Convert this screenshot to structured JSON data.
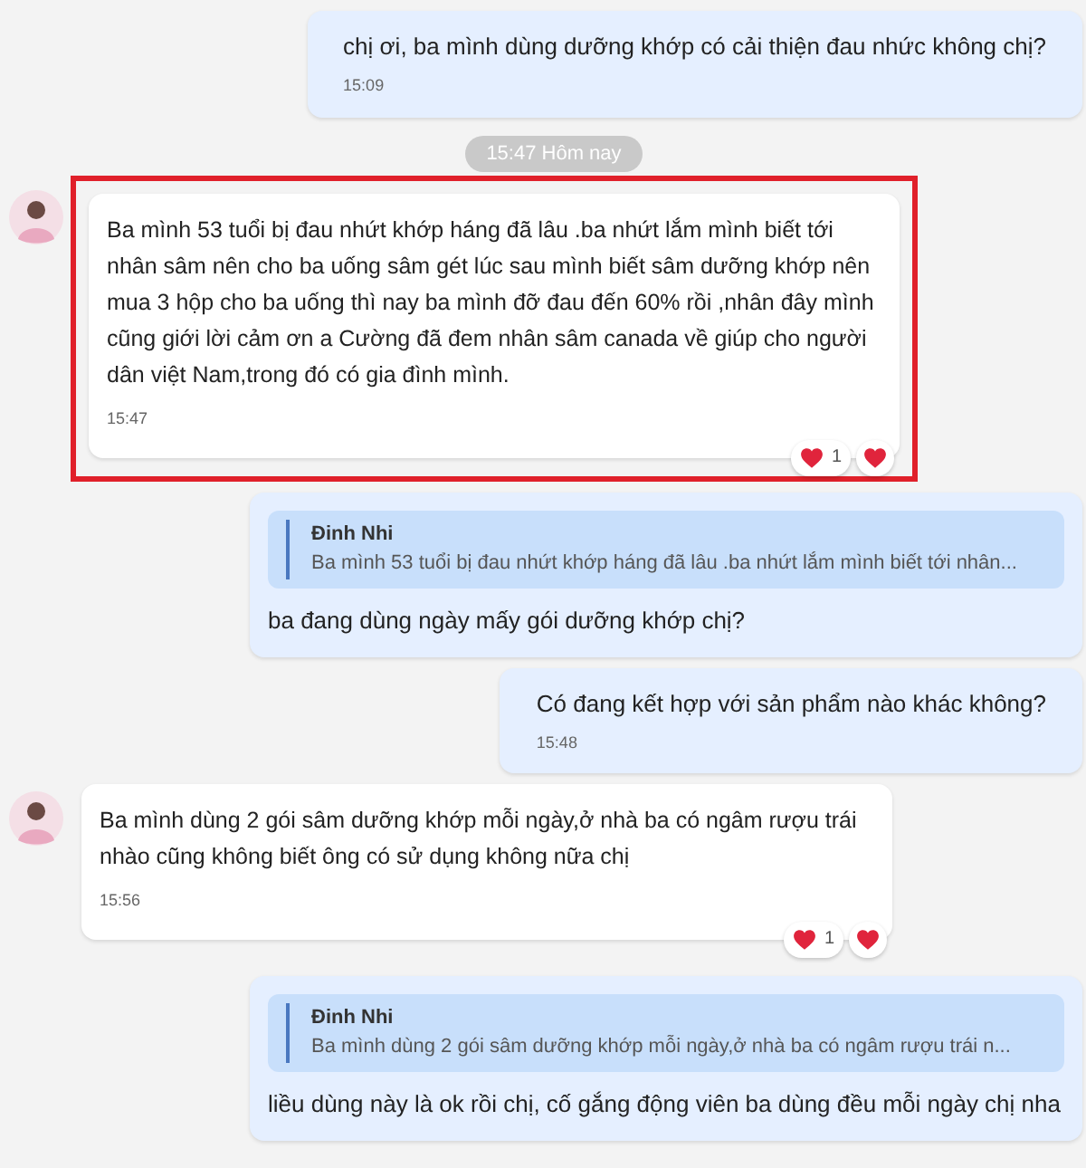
{
  "messages": [
    {
      "kind": "outgoing",
      "text": "chị ơi, ba mình dùng dưỡng khớp có cải thiện đau nhức không chị?",
      "time": "15:09"
    },
    {
      "kind": "divider",
      "text": "15:47 Hôm nay"
    },
    {
      "kind": "incoming",
      "highlighted": true,
      "text": "Ba mình 53 tuổi bị đau nhứt khớp háng đã lâu .ba nhứt lắm mình biết tới nhân sâm nên cho ba uống sâm gét lúc sau mình biết  sâm dưỡng khớp nên mua 3 hộp cho ba uống thì nay ba mình đỡ đau đến 60% rồi ,nhân đây mình cũng giới lời cảm ơn a Cường đã đem nhân sâm canada về giúp cho người dân việt Nam,trong đó có gia đình mình.",
      "time": "15:47",
      "reactions": [
        {
          "kind": "count",
          "count": "1"
        },
        {
          "kind": "add"
        }
      ]
    },
    {
      "kind": "outgoing",
      "quote": {
        "author": "Đinh Nhi",
        "text": "Ba mình 53 tuổi bị đau nhứt khớp háng đã lâu .ba nhứt lắm mình biết tới nhân..."
      },
      "text": "ba đang dùng ngày mấy gói dưỡng khớp chị?"
    },
    {
      "kind": "outgoing",
      "text": "Có đang kết hợp với sản phẩm nào khác không?",
      "time": "15:48"
    },
    {
      "kind": "incoming",
      "highlighted": false,
      "text": "Ba mình dùng 2 gói sâm dưỡng khớp mỗi ngày,ở nhà ba có ngâm rượu trái nhào cũng không biết ông có sử dụng không  nữa chị",
      "time": "15:56",
      "reactions": [
        {
          "kind": "count",
          "count": "1"
        },
        {
          "kind": "add"
        }
      ]
    },
    {
      "kind": "outgoing",
      "quote": {
        "author": "Đinh Nhi",
        "text": "Ba mình dùng 2 gói sâm dưỡng khớp mỗi ngày,ở nhà ba có ngâm rượu trái n..."
      },
      "text": "liều dùng này là ok rồi chị, cố gắng động viên ba dùng đều mỗi ngày chị nha"
    }
  ]
}
